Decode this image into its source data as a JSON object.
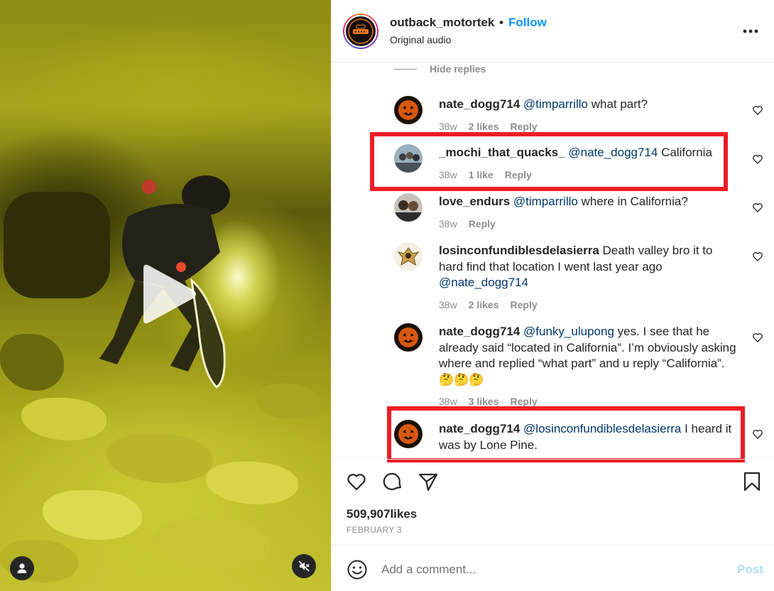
{
  "video": {
    "play_icon": "play-icon",
    "profile_icon": "person-icon",
    "mute_icon": "speaker-muted-icon"
  },
  "header": {
    "username": "outback_motortek",
    "separator": "•",
    "follow_label": "Follow",
    "audio": "Original audio",
    "more_icon": "more-horizontal-icon"
  },
  "comments": {
    "hide_replies": "Hide replies",
    "items": [
      {
        "user": "nate_dogg714",
        "mention": "@timparrillo",
        "text": " what part?",
        "time": "38w",
        "likes": "2 likes",
        "reply": "Reply",
        "highlighted": false
      },
      {
        "user": "_mochi_that_quacks_",
        "mention": "@nate_dogg714",
        "text": " California",
        "time": "38w",
        "likes": "1 like",
        "reply": "Reply",
        "highlighted": true
      },
      {
        "user": "love_endurs",
        "mention": "@timparrillo",
        "text": " where in California?",
        "time": "38w",
        "likes": "",
        "reply": "Reply",
        "highlighted": false
      },
      {
        "user": "losinconfundiblesdelasierra",
        "text": " Death valley bro it to hard find that location I went last year ago ",
        "mention_after": "@nate_dogg714",
        "time": "38w",
        "likes": "2 likes",
        "reply": "Reply",
        "highlighted": false
      },
      {
        "user": "nate_dogg714",
        "mention": "@funky_ulupong",
        "text": " yes. I see that he already said “located in California”. I’m obviously asking where and replied “what part” and u reply “California”. 🤔🤔🤔",
        "time": "38w",
        "likes": "3 likes",
        "reply": "Reply",
        "highlighted": false
      },
      {
        "user": "nate_dogg714",
        "mention": "@losinconfundiblesdelasierra",
        "text": " I heard it was by Lone Pine.",
        "time": "",
        "likes": "",
        "reply": "",
        "highlighted": true
      }
    ]
  },
  "actions": {
    "like_icon": "heart-icon",
    "comment_icon": "comment-icon",
    "share_icon": "paper-plane-icon",
    "save_icon": "bookmark-icon",
    "likes_count": "509,907",
    "likes_suffix": "likes",
    "date": "FEBRUARY 3"
  },
  "comment_bar": {
    "emoji_icon": "smiley-icon",
    "placeholder": "Add a comment...",
    "post_label": "Post"
  },
  "colors": {
    "highlight": "#ee1c24",
    "link": "#0095f6",
    "mention": "#00376b",
    "muted": "#8e8e8e",
    "post_disabled": "#b2dffc"
  }
}
